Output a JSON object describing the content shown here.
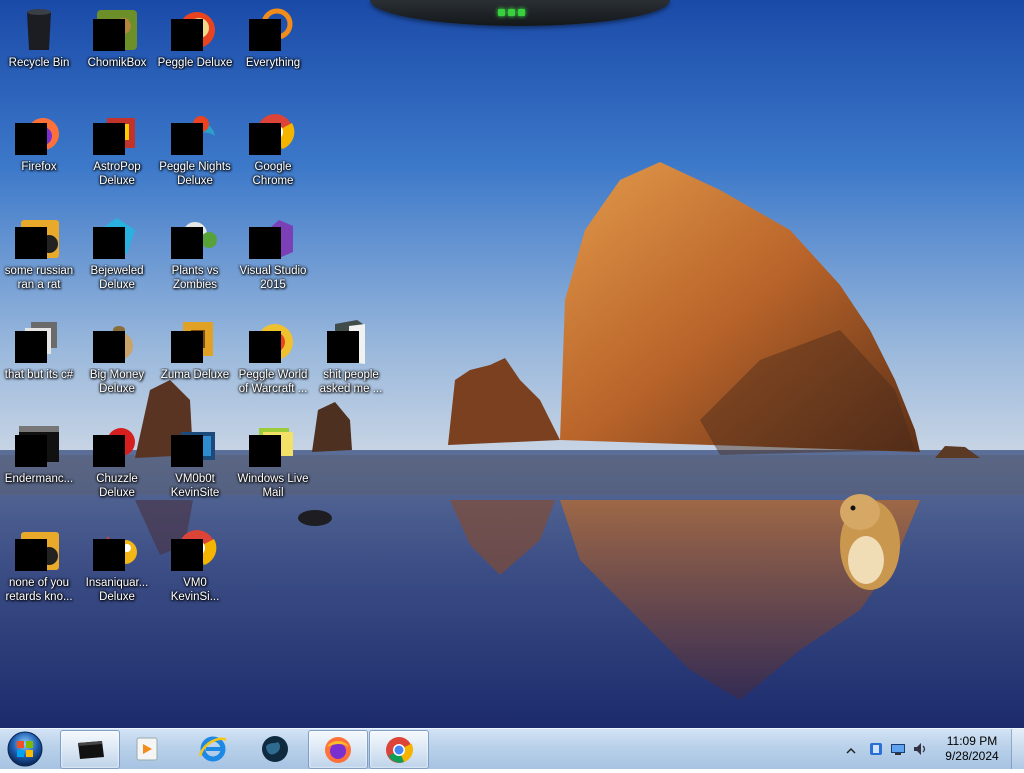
{
  "desktop": {
    "icons": [
      {
        "label": "Recycle Bin",
        "icon": "recycle-bin-icon"
      },
      {
        "label": "ChomikBox",
        "icon": "chomikbox-icon"
      },
      {
        "label": "Peggle Deluxe",
        "icon": "peggle-deluxe-icon"
      },
      {
        "label": "Everything",
        "icon": "everything-icon"
      },
      {
        "label": "Firefox",
        "icon": "firefox-icon"
      },
      {
        "label": "AstroPop\nDeluxe",
        "icon": "astropop-icon"
      },
      {
        "label": "Peggle Nights\nDeluxe",
        "icon": "peggle-nights-icon"
      },
      {
        "label": "Google\nChrome",
        "icon": "chrome-icon"
      },
      {
        "label": "some russian\nran a rat",
        "icon": "generic-app-icon"
      },
      {
        "label": "Bejeweled\nDeluxe",
        "icon": "bejeweled-icon"
      },
      {
        "label": "Plants vs\nZombies",
        "icon": "plants-vs-zombies-icon"
      },
      {
        "label": "Visual Studio\n2015",
        "icon": "visual-studio-icon"
      },
      {
        "label": "that but its c#",
        "icon": "shortcut-icon"
      },
      {
        "label": "Big Money\nDeluxe",
        "icon": "big-money-icon"
      },
      {
        "label": "Zuma Deluxe",
        "icon": "zuma-icon"
      },
      {
        "label": "Peggle World\nof Warcraft ...",
        "icon": "peggle-wow-icon"
      },
      {
        "label": "shit people\nasked me ...",
        "icon": "folder-icon"
      },
      {
        "label": "Endermanc...",
        "icon": "console-icon"
      },
      {
        "label": "Chuzzle\nDeluxe",
        "icon": "chuzzle-icon"
      },
      {
        "label": "VM0b0t\nKevinSite",
        "icon": "vm-icon"
      },
      {
        "label": "Windows Live\nMail",
        "icon": "windows-live-mail-icon"
      },
      {
        "label": "none of you\nretards kno...",
        "icon": "generic-app-icon"
      },
      {
        "label": "Insaniquar...\nDeluxe",
        "icon": "insaniquarium-icon"
      },
      {
        "label": "VM0\nKevinSi...",
        "icon": "chrome-icon"
      }
    ]
  },
  "taskbar": {
    "start": "start-orb-icon",
    "pinned": [
      {
        "name": "cmd-window",
        "icon": "command-window-icon",
        "active": true
      },
      {
        "name": "media-player",
        "icon": "media-player-icon",
        "active": false
      },
      {
        "name": "internet-explorer",
        "icon": "internet-explorer-icon",
        "active": false
      },
      {
        "name": "globe-app",
        "icon": "globe-icon",
        "active": false
      },
      {
        "name": "firefox",
        "icon": "firefox-icon",
        "active": true
      },
      {
        "name": "chrome",
        "icon": "chrome-icon",
        "active": true
      }
    ],
    "tray": {
      "time": "11:09 PM",
      "date": "9/28/2024"
    }
  },
  "colors": {
    "taskbar_top": "#d2e3f4",
    "taskbar_bottom": "#a7c3e2",
    "label_text": "#ffffff",
    "sky_top": "#1d52b2",
    "sky_bottom": "#b8cbe2"
  }
}
